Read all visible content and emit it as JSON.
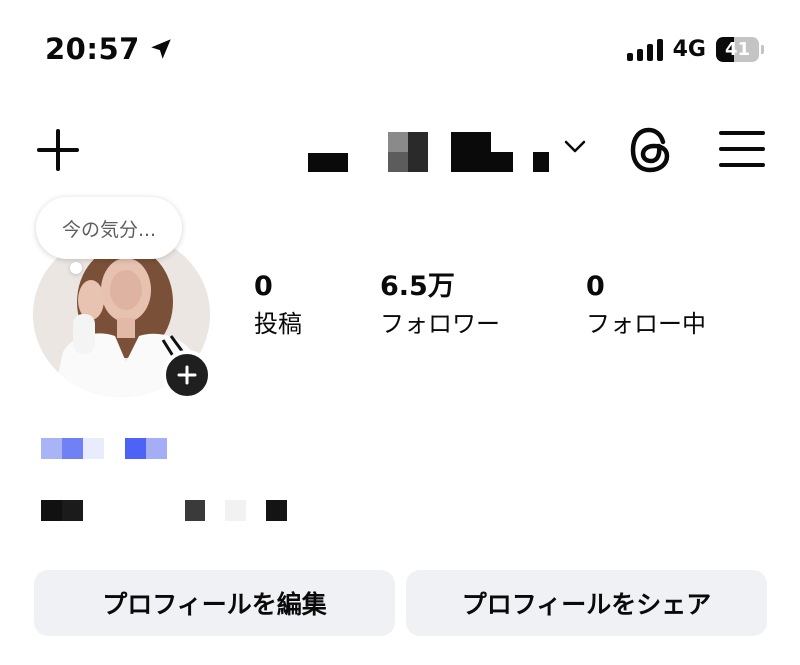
{
  "status_bar": {
    "time": "20:57",
    "network": "4G",
    "battery_level": "41",
    "battery_fraction": 0.41,
    "location_icon": "location-arrow-icon"
  },
  "header": {
    "create_icon": "plus-icon",
    "username_dropdown_icon": "chevron-down-icon",
    "threads_icon": "threads-icon",
    "menu_icon": "hamburger-menu-icon"
  },
  "profile": {
    "note_placeholder": "今の気分...",
    "stats": {
      "posts": {
        "count": "0",
        "label": "投稿"
      },
      "followers": {
        "count": "6.5万",
        "label": "フォロワー"
      },
      "following": {
        "count": "0",
        "label": "フォロー中"
      }
    }
  },
  "actions": {
    "edit_profile": "プロフィールを編集",
    "share_profile": "プロフィールをシェア"
  },
  "colors": {
    "background": "#ffffff",
    "text": "#0a0a0a",
    "button_bg": "#eff1f4",
    "note_text": "#5f5f5f",
    "link_blue": "#4c63f5"
  }
}
